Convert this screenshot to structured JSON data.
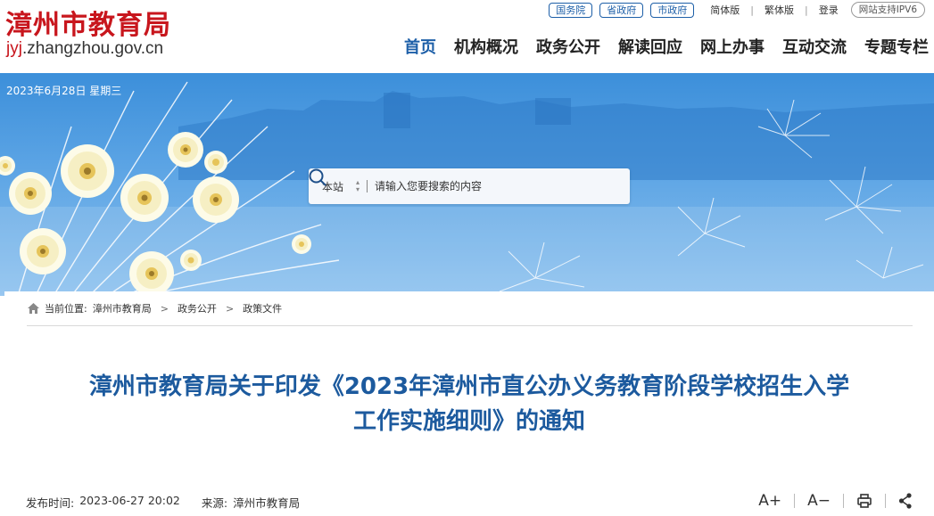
{
  "header": {
    "logo_title": "漳州市教育局",
    "logo_url_prefix": "jyj",
    "logo_url_rest": ".zhangzhou.gov.cn",
    "top_links": [
      "国务院",
      "省政府",
      "市政府"
    ],
    "lang_simplified": "简体版",
    "lang_traditional": "繁体版",
    "login": "登录",
    "ipv6": "网站支持IPV6",
    "nav": [
      "首页",
      "机构概况",
      "政务公开",
      "解读回应",
      "网上办事",
      "互动交流",
      "专题专栏"
    ]
  },
  "banner": {
    "date": "2023年6月28日 星期三"
  },
  "search": {
    "scope": "本站",
    "placeholder": "请输入您要搜索的内容"
  },
  "breadcrumb": {
    "label": "当前位置:",
    "items": [
      "漳州市教育局",
      "政务公开",
      "政策文件"
    ],
    "arrow": ">"
  },
  "article": {
    "title_line1": "漳州市教育局关于印发《2023年漳州市直公办义务教育阶段学校招生入学",
    "title_line2": "工作实施细则》的通知",
    "publish_label": "发布时间:",
    "publish_time": "2023-06-27 20:02",
    "source_label": "来源:",
    "source": "漳州市教育局"
  },
  "tools": {
    "font_larger": "A+",
    "font_smaller": "A−"
  },
  "colors": {
    "brand_red": "#c8161d",
    "nav_blue": "#1d5fa8",
    "title_blue": "#1c5a9e",
    "banner_blue": "#4a98df"
  }
}
